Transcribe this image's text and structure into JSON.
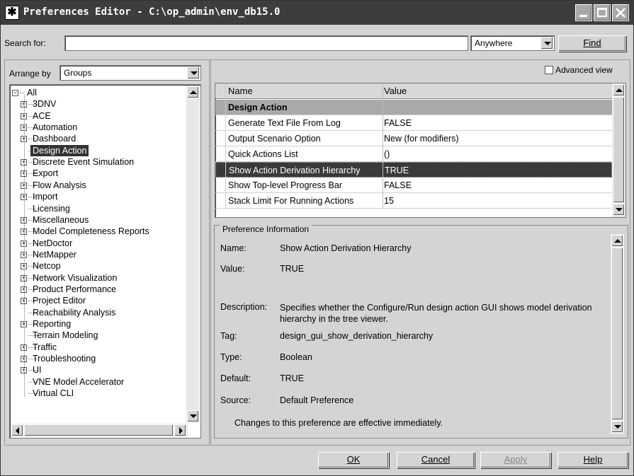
{
  "window": {
    "title": "Preferences Editor - C:\\op_admin\\env_db15.0",
    "icon": "asterisk-app-icon"
  },
  "search": {
    "label": "Search for:",
    "value": "",
    "scope": "Anywhere",
    "find_label": "Find"
  },
  "arrange": {
    "label": "Arrange by",
    "value": "Groups"
  },
  "tree": {
    "items": [
      {
        "label": "All",
        "level": 0,
        "expander": "minus"
      },
      {
        "label": "3DNV",
        "level": 1,
        "expander": "plus"
      },
      {
        "label": "ACE",
        "level": 1,
        "expander": "plus"
      },
      {
        "label": "Automation",
        "level": 1,
        "expander": "plus"
      },
      {
        "label": "Dashboard",
        "level": 1,
        "expander": "plus"
      },
      {
        "label": "Design Action",
        "level": 1,
        "expander": "none",
        "selected": true
      },
      {
        "label": "Discrete Event Simulation",
        "level": 1,
        "expander": "plus"
      },
      {
        "label": "Export",
        "level": 1,
        "expander": "plus"
      },
      {
        "label": "Flow Analysis",
        "level": 1,
        "expander": "plus"
      },
      {
        "label": "Import",
        "level": 1,
        "expander": "plus"
      },
      {
        "label": "Licensing",
        "level": 1,
        "expander": "none"
      },
      {
        "label": "Miscellaneous",
        "level": 1,
        "expander": "plus"
      },
      {
        "label": "Model Completeness Reports",
        "level": 1,
        "expander": "plus"
      },
      {
        "label": "NetDoctor",
        "level": 1,
        "expander": "plus"
      },
      {
        "label": "NetMapper",
        "level": 1,
        "expander": "plus"
      },
      {
        "label": "Netcop",
        "level": 1,
        "expander": "plus"
      },
      {
        "label": "Network Visualization",
        "level": 1,
        "expander": "plus"
      },
      {
        "label": "Product Performance",
        "level": 1,
        "expander": "plus"
      },
      {
        "label": "Project Editor",
        "level": 1,
        "expander": "plus"
      },
      {
        "label": "Reachability Analysis",
        "level": 1,
        "expander": "none"
      },
      {
        "label": "Reporting",
        "level": 1,
        "expander": "plus"
      },
      {
        "label": "Terrain Modeling",
        "level": 1,
        "expander": "none"
      },
      {
        "label": "Traffic",
        "level": 1,
        "expander": "plus"
      },
      {
        "label": "Troubleshooting",
        "level": 1,
        "expander": "plus"
      },
      {
        "label": "UI",
        "level": 1,
        "expander": "plus"
      },
      {
        "label": "VNE Model Accelerator",
        "level": 1,
        "expander": "none"
      },
      {
        "label": "Virtual CLI",
        "level": 1,
        "expander": "none"
      }
    ]
  },
  "advanced_view": {
    "label": "Advanced view",
    "checked": false
  },
  "grid": {
    "col_name": "Name",
    "col_value": "Value",
    "rows": [
      {
        "name": "Design Action",
        "value": "",
        "kind": "group"
      },
      {
        "name": "Generate Text File From Log",
        "value": "FALSE"
      },
      {
        "name": "Output Scenario Option",
        "value": "New (for modifiers)"
      },
      {
        "name": "Quick Actions List",
        "value": "()"
      },
      {
        "name": "Show Action Derivation Hierarchy",
        "value": "TRUE",
        "selected": true
      },
      {
        "name": "Show Top-level Progress Bar",
        "value": "FALSE"
      },
      {
        "name": "Stack Limit For Running Actions",
        "value": "15"
      }
    ]
  },
  "info": {
    "legend": "Preference Information",
    "name_label": "Name:",
    "name_value": "Show Action Derivation Hierarchy",
    "value_label": "Value:",
    "value_value": "TRUE",
    "desc_label": "Description:",
    "desc_value": "Specifies whether the Configure/Run design action GUI shows model derivation hierarchy in the tree viewer.",
    "tag_label": "Tag:",
    "tag_value": "design_gui_show_derivation_hierarchy",
    "type_label": "Type:",
    "type_value": "Boolean",
    "default_label": "Default:",
    "default_value": "TRUE",
    "source_label": "Source:",
    "source_value": "Default Preference",
    "note": "Changes to this preference are effective immediately."
  },
  "buttons": {
    "ok": "OK",
    "cancel": "Cancel",
    "apply": "Apply",
    "help": "Help"
  }
}
